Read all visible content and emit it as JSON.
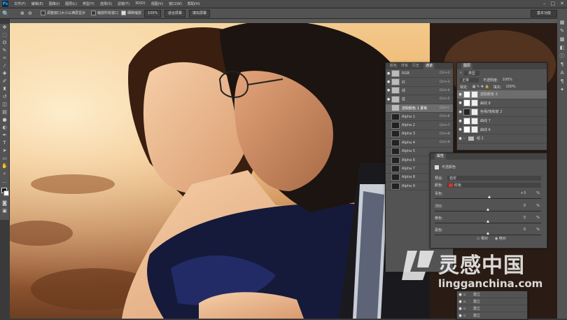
{
  "menubar": {
    "app_logo": "Ps",
    "menus": [
      "文件(F)",
      "编辑(E)",
      "图像(I)",
      "图层(L)",
      "类型(Y)",
      "选择(S)",
      "滤镜(T)",
      "3D(D)",
      "视图(V)",
      "窗口(W)",
      "帮助(H)"
    ],
    "window_controls": [
      "–",
      "□",
      "✕"
    ]
  },
  "options": {
    "resize_windows": "调整窗口大小以满屏显示",
    "zoom_all": "缩放所有窗口",
    "scrubby_zoom": "细微缩放",
    "zoom_value": "100%",
    "fit_screen": "适合屏幕",
    "fill_screen": "填充屏幕",
    "workspace": "基本功能"
  },
  "channels_panel": {
    "tabs": [
      "颜色",
      "样板",
      "历史",
      "通道"
    ],
    "active_tab": "通道",
    "rows": [
      {
        "name": "RGB",
        "shortcut": "Ctrl+2",
        "eye": "●",
        "light": true
      },
      {
        "name": "红",
        "shortcut": "Ctrl+3",
        "eye": "●",
        "light": true
      },
      {
        "name": "绿",
        "shortcut": "Ctrl+4",
        "eye": "●",
        "light": true
      },
      {
        "name": "蓝",
        "shortcut": "Ctrl+5",
        "eye": "●",
        "light": true
      },
      {
        "name": "选取颜色 1 蒙板",
        "shortcut": "Ctrl+\\",
        "eye": "",
        "light": true,
        "selected": true
      },
      {
        "name": "Alpha 1",
        "shortcut": "Ctrl+6",
        "eye": "",
        "light": false
      },
      {
        "name": "Alpha 2",
        "shortcut": "Ctrl+7",
        "eye": "",
        "light": false
      },
      {
        "name": "Alpha 3",
        "shortcut": "Ctrl+8",
        "eye": "",
        "light": false
      },
      {
        "name": "Alpha 4",
        "shortcut": "Ctrl+9",
        "eye": "",
        "light": false
      },
      {
        "name": "Alpha 5",
        "shortcut": "",
        "eye": "",
        "light": false
      },
      {
        "name": "Alpha 6",
        "shortcut": "",
        "eye": "",
        "light": false
      },
      {
        "name": "Alpha 7",
        "shortcut": "",
        "eye": "",
        "light": false
      },
      {
        "name": "Alpha 8",
        "shortcut": "",
        "eye": "",
        "light": false
      },
      {
        "name": "Alpha 9",
        "shortcut": "",
        "eye": "",
        "light": false
      }
    ]
  },
  "layers_panel": {
    "tab": "图层",
    "kind_filter": "类型",
    "blend_mode": "正常",
    "opacity_label": "不透明度:",
    "opacity_value": "100%",
    "lock_label": "锁定:",
    "fill_label": "填充:",
    "fill_value": "100%",
    "rows": [
      {
        "name": "选取颜色 3",
        "selected": true,
        "kind": "adj"
      },
      {
        "name": "曲线 8",
        "kind": "adj"
      },
      {
        "name": "色相/饱和度 2",
        "kind": "adj"
      },
      {
        "name": "曲线 7",
        "kind": "adj"
      },
      {
        "name": "曲线 6",
        "kind": "adj"
      },
      {
        "name": "组 2",
        "kind": "group"
      }
    ]
  },
  "properties_panel": {
    "tab": "属性",
    "title": "可选颜色",
    "preset_label": "预设:",
    "preset_value": "自定",
    "colors_label": "颜色:",
    "colors_value": "红色",
    "color_swatch": "#d8312b",
    "sliders": [
      {
        "label": "青色:",
        "value": "+3",
        "percent": "%",
        "fraction": 0.515
      },
      {
        "label": "洋红:",
        "value": "0",
        "percent": "%",
        "fraction": 0.5
      },
      {
        "label": "黄色:",
        "value": "0",
        "percent": "%",
        "fraction": 0.5
      },
      {
        "label": "黑色:",
        "value": "0",
        "percent": "%",
        "fraction": 0.5
      }
    ],
    "relative": "相对",
    "absolute": "绝对"
  },
  "bottom_layers": [
    "建立",
    "建立",
    "建立",
    "建立"
  ],
  "watermark": {
    "brand_cn": "灵感中国",
    "site": "lingganchina.com"
  }
}
